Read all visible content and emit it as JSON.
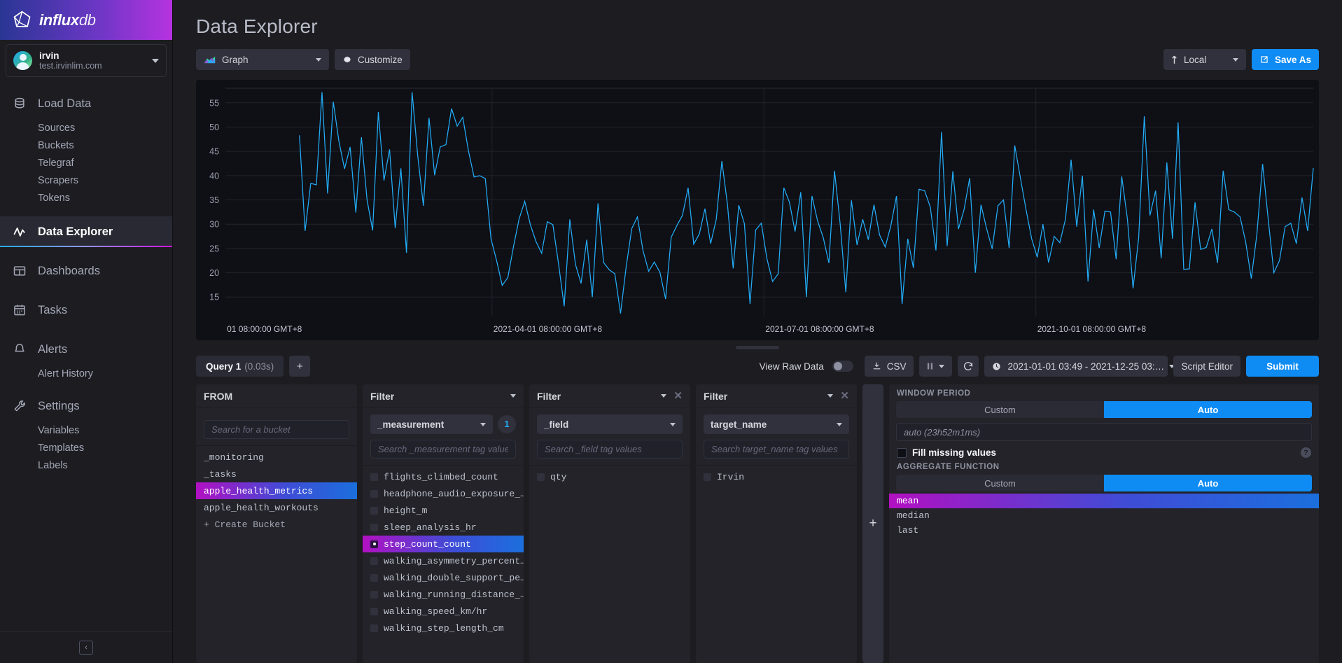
{
  "brand": {
    "name_bold": "influx",
    "name_thin": "db",
    "logo_icon": "influxdb-logo-icon"
  },
  "user": {
    "name": "irvin",
    "org": "test.irvinlim.com"
  },
  "sidebar": {
    "groups": [
      {
        "label": "Load Data",
        "icon": "database-icon",
        "active": false,
        "children": [
          "Sources",
          "Buckets",
          "Telegraf",
          "Scrapers",
          "Tokens"
        ]
      },
      {
        "label": "Data Explorer",
        "icon": "line-graph-icon",
        "active": true,
        "children": []
      },
      {
        "label": "Dashboards",
        "icon": "dashboards-grid-icon",
        "active": false,
        "children": []
      },
      {
        "label": "Tasks",
        "icon": "calendar-icon",
        "active": false,
        "children": []
      },
      {
        "label": "Alerts",
        "icon": "bell-icon",
        "active": false,
        "children": [
          "Alert History"
        ]
      },
      {
        "label": "Settings",
        "icon": "wrench-icon",
        "active": false,
        "children": [
          "Variables",
          "Templates",
          "Labels"
        ]
      }
    ],
    "collapse_label": "‹"
  },
  "header": {
    "title": "Data Explorer"
  },
  "toolbar": {
    "view_type": "Graph",
    "view_type_icon": "graph-thumbnail-icon",
    "customize": "Customize",
    "customize_icon": "gear-icon",
    "timezone": "Local",
    "timezone_icon": "clock-arrow-icon",
    "save_as": "Save As",
    "save_as_icon": "export-icon"
  },
  "query_bar": {
    "query_tab": "Query 1",
    "query_duration": "(0.03s)",
    "add_query_label": "+",
    "view_raw_data": "View Raw Data",
    "raw_toggle_on": false,
    "csv": "CSV",
    "csv_icon": "download-icon",
    "pause_icon": "pause-icon",
    "refresh_icon": "refresh-icon",
    "time_range": "2021-01-01 03:49 - 2021-12-25 03:…",
    "time_range_icon": "clock-icon",
    "script_editor": "Script Editor",
    "submit": "Submit"
  },
  "builder": {
    "from": {
      "title": "FROM",
      "search_placeholder": "Search for a bucket",
      "search_value": "",
      "buckets": [
        "_monitoring",
        "_tasks",
        "apple_health_metrics",
        "apple_health_workouts"
      ],
      "selected_bucket": "apple_health_metrics",
      "create_bucket": "+ Create Bucket"
    },
    "filters": [
      {
        "title": "Filter",
        "tag_key": "_measurement",
        "count": "1",
        "closable": false,
        "search_placeholder": "Search _measurement tag values",
        "search_value": "",
        "values": [
          "flights_climbed_count",
          "headphone_audio_exposure_…",
          "height_m",
          "sleep_analysis_hr",
          "step_count_count",
          "walking_asymmetry_percent…",
          "walking_double_support_pe…",
          "walking_running_distance_…",
          "walking_speed_km/hr",
          "walking_step_length_cm"
        ],
        "selected": [
          "step_count_count"
        ]
      },
      {
        "title": "Filter",
        "tag_key": "_field",
        "count": "",
        "closable": true,
        "search_placeholder": "Search _field tag values",
        "search_value": "",
        "values": [
          "qty"
        ],
        "selected": []
      },
      {
        "title": "Filter",
        "tag_key": "target_name",
        "count": "",
        "closable": true,
        "search_placeholder": "Search target_name tag values",
        "search_value": "",
        "values": [
          "Irvin"
        ],
        "selected": []
      }
    ],
    "add_filter_label": "+"
  },
  "options": {
    "window_period_title": "Window Period",
    "window_custom": "Custom",
    "window_auto": "Auto",
    "window_mode": "Auto",
    "window_auto_value": "auto (23h52m1ms)",
    "fill_missing": "Fill missing values",
    "fill_checked": false,
    "help_label": "?",
    "aggregate_title": "Aggregate Function",
    "agg_custom": "Custom",
    "agg_auto": "Auto",
    "agg_mode": "Auto",
    "agg_functions": [
      "mean",
      "median",
      "last"
    ],
    "agg_selected": "mean"
  },
  "colors": {
    "accent_blue": "#0f8cf4",
    "line_color": "#22ADF6",
    "selected_gradient_start": "#b210c2",
    "selected_gradient_end": "#1b6fdd",
    "panel_bg": "#232329",
    "chart_bg": "#0f0f16"
  },
  "chart_data": {
    "type": "line",
    "title": "",
    "xlabel": "",
    "ylabel": "",
    "ylim": [
      11,
      58
    ],
    "yticks": [
      15,
      20,
      25,
      30,
      35,
      40,
      45,
      50,
      55
    ],
    "xticks": [
      "01 08:00:00 GMT+8",
      "2021-04-01 08:00:00 GMT+8",
      "2021-07-01 08:00:00 GMT+8",
      "2021-10-01 08:00:00 GMT+8"
    ],
    "xtick_positions": [
      0.0,
      0.245,
      0.495,
      0.745
    ],
    "grid": true,
    "legend": "none",
    "series": [
      {
        "name": "step_count_count",
        "color": "#22ADF6",
        "values": [
          48.3,
          28.6,
          38.4,
          38.1,
          57.2,
          36.3,
          55.2,
          47.1,
          41.4,
          45.9,
          32.4,
          47.9,
          35.0,
          28.7,
          53.1,
          39.0,
          45.4,
          29.2,
          41.5,
          24.1,
          57.2,
          44.1,
          33.8,
          51.9,
          40.1,
          45.9,
          46.4,
          53.8,
          50.2,
          52.0,
          45.1,
          39.7,
          40.0,
          39.4,
          27.0,
          22.5,
          17.4,
          19.0,
          25.4,
          31.1,
          34.7,
          29.9,
          26.4,
          24.0,
          30.5,
          29.9,
          21.8,
          13.1,
          31.0,
          21.7,
          17.8,
          26.8,
          15.0,
          34.3,
          22.1,
          20.6,
          19.8,
          11.6,
          21.2,
          29.1,
          31.5,
          24.5,
          20.3,
          22.2,
          20.1,
          14.6,
          27.3,
          29.7,
          31.8,
          37.5,
          25.9,
          28.0,
          33.2,
          26.0,
          31.0,
          43.0,
          34.0,
          20.9,
          33.9,
          30.1,
          13.6,
          28.8,
          30.2,
          22.9,
          18.2,
          19.8,
          37.5,
          34.5,
          28.5,
          36.6,
          15.0,
          35.8,
          30.6,
          27.2,
          22.0,
          41.0,
          30.0,
          16.0,
          34.9,
          25.7,
          31.0,
          26.8,
          34.0,
          27.8,
          25.3,
          29.7,
          35.8,
          13.6,
          27.0,
          21.0,
          37.2,
          36.9,
          33.5,
          24.6,
          49.0,
          25.5,
          40.9,
          29.0,
          33.0,
          39.5,
          20.0,
          34.0,
          29.1,
          24.9,
          33.8,
          35.0,
          25.1,
          46.2,
          39.5,
          33.0,
          27.0,
          23.2,
          30.0,
          22.1,
          27.5,
          26.2,
          31.0,
          43.3,
          29.5,
          40.0,
          18.2,
          33.0,
          25.1,
          32.7,
          32.5,
          22.8,
          39.8,
          31.0,
          16.8,
          27.2,
          52.2,
          31.8,
          36.9,
          23.0,
          42.7,
          27.0,
          51.0,
          20.7,
          20.8,
          34.5,
          24.8,
          25.2,
          29.0,
          22.0,
          41.0,
          33.0,
          32.5,
          31.5,
          26.3,
          18.8,
          28.0,
          42.4,
          31.0,
          20.0,
          22.5,
          29.5,
          30.2,
          26.0,
          35.5,
          28.6,
          41.6
        ]
      }
    ]
  }
}
